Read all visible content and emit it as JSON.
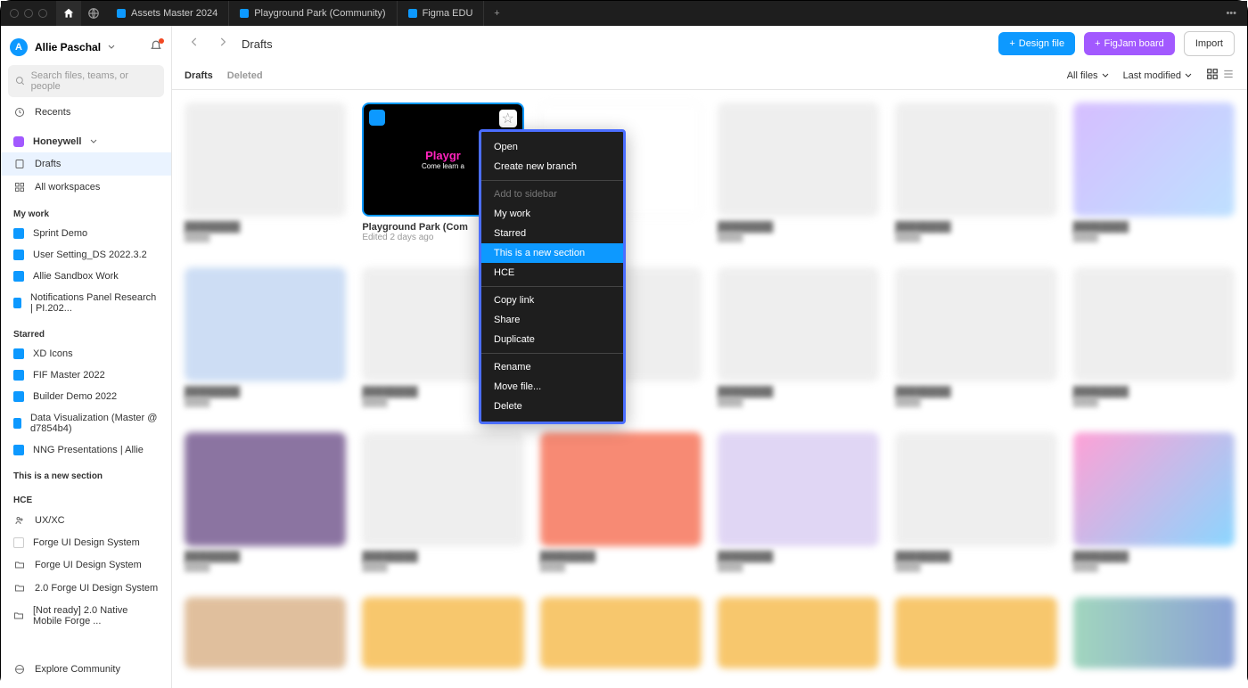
{
  "topbar": {
    "tabs": [
      {
        "label": "Assets Master 2024"
      },
      {
        "label": "Playground Park (Community)"
      },
      {
        "label": "Figma EDU"
      }
    ]
  },
  "user": {
    "initial": "A",
    "name": "Allie Paschal"
  },
  "search_placeholder": "Search files, teams, or people",
  "sidebar": {
    "recents": "Recents",
    "org": "Honeywell",
    "drafts": "Drafts",
    "workspaces": "All workspaces",
    "mywork_header": "My work",
    "mywork": [
      "Sprint Demo",
      "User Setting_DS 2022.3.2",
      "Allie Sandbox Work",
      "Notifications Panel Research | PI.202..."
    ],
    "starred_header": "Starred",
    "starred": [
      "XD Icons",
      "FIF Master 2022",
      "Builder Demo 2022",
      "Data Visualization (Master @ d7854b4)",
      "NNG Presentations | Allie"
    ],
    "new_section": "This is a new section",
    "hce_header": "HCE",
    "hce": [
      "UX/XC",
      "Forge UI Design System",
      "Forge UI Design System",
      "2.0 Forge UI Design System",
      "[Not ready] 2.0 Native Mobile Forge ..."
    ],
    "explore": "Explore Community"
  },
  "header": {
    "crumb": "Drafts",
    "design_btn": "Design file",
    "figjam_btn": "FigJam board",
    "import_btn": "Import"
  },
  "tabbar": {
    "drafts": "Drafts",
    "deleted": "Deleted",
    "filter_files": "All files",
    "filter_sort": "Last modified"
  },
  "focused_card": {
    "thumb_title": "Playgr",
    "thumb_sub": "Come learn a",
    "title": "Playground Park (Com",
    "meta": "Edited 2 days ago"
  },
  "context_menu": {
    "open": "Open",
    "branch": "Create new branch",
    "add_sidebar": "Add to sidebar",
    "mywork": "My work",
    "starred": "Starred",
    "newsection": "This is a new section",
    "hce": "HCE",
    "copylink": "Copy link",
    "share": "Share",
    "duplicate": "Duplicate",
    "rename": "Rename",
    "move": "Move file...",
    "delete": "Delete"
  }
}
